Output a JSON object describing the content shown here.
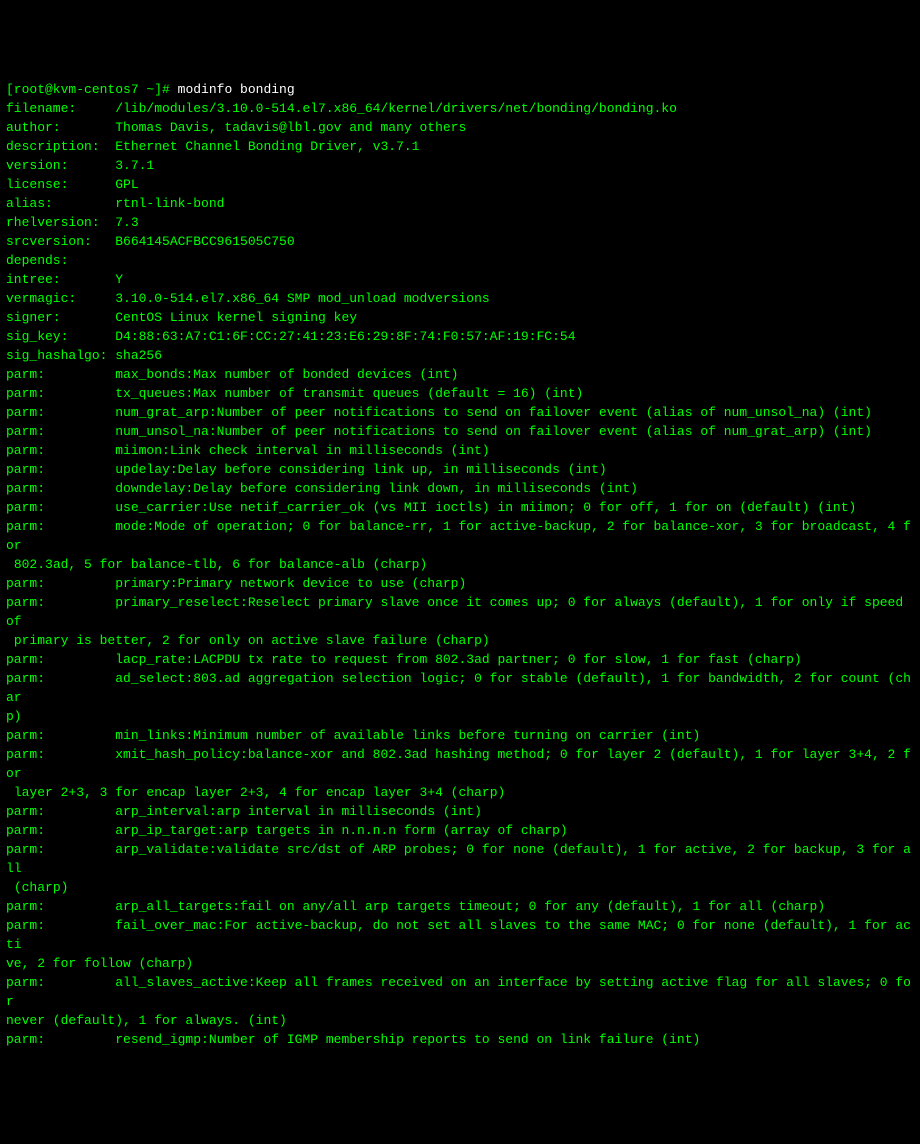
{
  "prompt": "[root@kvm-centos7 ~]# ",
  "command": "modinfo bonding",
  "fields": [
    {
      "label": "filename:",
      "value": "/lib/modules/3.10.0-514.el7.x86_64/kernel/drivers/net/bonding/bonding.ko"
    },
    {
      "label": "author:",
      "value": "Thomas Davis, tadavis@lbl.gov and many others"
    },
    {
      "label": "description:",
      "value": "Ethernet Channel Bonding Driver, v3.7.1"
    },
    {
      "label": "version:",
      "value": "3.7.1"
    },
    {
      "label": "license:",
      "value": "GPL"
    },
    {
      "label": "alias:",
      "value": "rtnl-link-bond"
    },
    {
      "label": "rhelversion:",
      "value": "7.3"
    },
    {
      "label": "srcversion:",
      "value": "B664145ACFBCC961505C750"
    },
    {
      "label": "depends:",
      "value": ""
    },
    {
      "label": "intree:",
      "value": "Y"
    },
    {
      "label": "vermagic:",
      "value": "3.10.0-514.el7.x86_64 SMP mod_unload modversions"
    },
    {
      "label": "signer:",
      "value": "CentOS Linux kernel signing key"
    },
    {
      "label": "sig_key:",
      "value": "D4:88:63:A7:C1:6F:CC:27:41:23:E6:29:8F:74:F0:57:AF:19:FC:54"
    },
    {
      "label": "sig_hashalgo:",
      "value": "sha256"
    }
  ],
  "parms": [
    {
      "label": "parm:",
      "value": "max_bonds:Max number of bonded devices (int)"
    },
    {
      "label": "parm:",
      "value": "tx_queues:Max number of transmit queues (default = 16) (int)"
    },
    {
      "label": "parm:",
      "value": "num_grat_arp:Number of peer notifications to send on failover event (alias of num_unsol_na) (int)"
    },
    {
      "label": "parm:",
      "value": "num_unsol_na:Number of peer notifications to send on failover event (alias of num_grat_arp) (int)"
    },
    {
      "label": "parm:",
      "value": "miimon:Link check interval in milliseconds (int)"
    },
    {
      "label": "parm:",
      "value": "updelay:Delay before considering link up, in milliseconds (int)"
    },
    {
      "label": "parm:",
      "value": "downdelay:Delay before considering link down, in milliseconds (int)"
    },
    {
      "label": "parm:",
      "value": "use_carrier:Use netif_carrier_ok (vs MII ioctls) in miimon; 0 for off, 1 for on (default) (int)"
    },
    {
      "label": "parm:",
      "value": "mode:Mode of operation; 0 for balance-rr, 1 for active-backup, 2 for balance-xor, 3 for broadcast, 4 for 802.3ad, 5 for balance-tlb, 6 for balance-alb (charp)"
    },
    {
      "label": "parm:",
      "value": "primary:Primary network device to use (charp)"
    },
    {
      "label": "parm:",
      "value": "primary_reselect:Reselect primary slave once it comes up; 0 for always (default), 1 for only if speed of primary is better, 2 for only on active slave failure (charp)"
    },
    {
      "label": "parm:",
      "value": "lacp_rate:LACPDU tx rate to request from 802.3ad partner; 0 for slow, 1 for fast (charp)"
    },
    {
      "label": "parm:",
      "value": "ad_select:803.ad aggregation selection logic; 0 for stable (default), 1 for bandwidth, 2 for count (charp)"
    },
    {
      "label": "parm:",
      "value": "min_links:Minimum number of available links before turning on carrier (int)"
    },
    {
      "label": "parm:",
      "value": "xmit_hash_policy:balance-xor and 802.3ad hashing method; 0 for layer 2 (default), 1 for layer 3+4, 2 for layer 2+3, 3 for encap layer 2+3, 4 for encap layer 3+4 (charp)"
    },
    {
      "label": "parm:",
      "value": "arp_interval:arp interval in milliseconds (int)"
    },
    {
      "label": "parm:",
      "value": "arp_ip_target:arp targets in n.n.n.n form (array of charp)"
    },
    {
      "label": "parm:",
      "value": "arp_validate:validate src/dst of ARP probes; 0 for none (default), 1 for active, 2 for backup, 3 for all (charp)"
    },
    {
      "label": "parm:",
      "value": "arp_all_targets:fail on any/all arp targets timeout; 0 for any (default), 1 for all (charp)"
    },
    {
      "label": "parm:",
      "value": "fail_over_mac:For active-backup, do not set all slaves to the same MAC; 0 for none (default), 1 for active, 2 for follow (charp)"
    },
    {
      "label": "parm:",
      "value": "all_slaves_active:Keep all frames received on an interface by setting active flag for all slaves; 0 for never (default), 1 for always. (int)"
    },
    {
      "label": "parm:",
      "value": "resend_igmp:Number of IGMP membership reports to send on link failure (int)"
    }
  ]
}
